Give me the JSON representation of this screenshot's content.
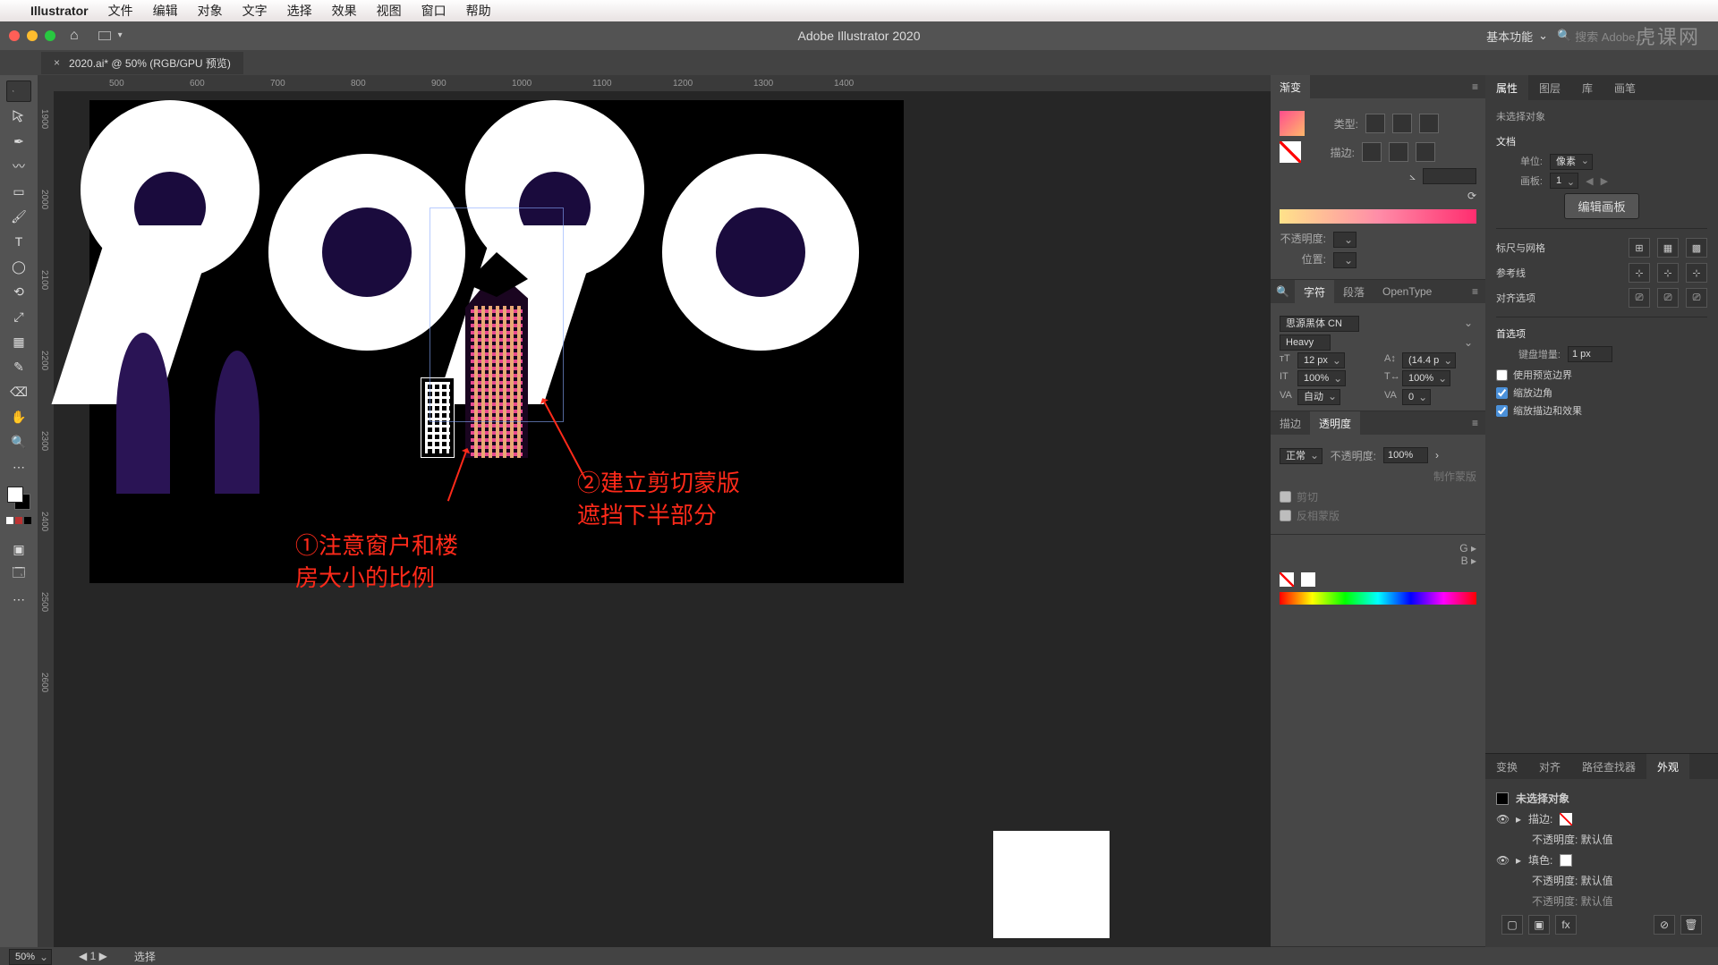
{
  "mac_menu": {
    "apple": "",
    "app": "Illustrator",
    "items": [
      "文件",
      "编辑",
      "对象",
      "文字",
      "选择",
      "效果",
      "视图",
      "窗口",
      "帮助"
    ]
  },
  "titlebar": {
    "title": "Adobe Illustrator 2020",
    "workspace": "基本功能",
    "search_placeholder": "搜索 Adobe..."
  },
  "watermark": "虎课网",
  "doctab": {
    "name": "2020.ai* @ 50% (RGB/GPU 预览)"
  },
  "ruler_h": [
    "500",
    "600",
    "700",
    "800",
    "900",
    "1000",
    "1100",
    "1200",
    "1300",
    "1400"
  ],
  "ruler_v": [
    "1900",
    "2000",
    "2100",
    "2200",
    "2300",
    "2400",
    "2500",
    "2600"
  ],
  "annotations": {
    "a1_l1": "①注意窗户和楼",
    "a1_l2": "房大小的比例",
    "a2_l1": "②建立剪切蒙版",
    "a2_l2": "遮挡下半部分"
  },
  "gradient": {
    "tab": "渐变",
    "type_label": "类型:",
    "stroke_label": "描边:",
    "opacity_label": "不透明度:",
    "position_label": "位置:"
  },
  "character": {
    "tab_char": "字符",
    "tab_para": "段落",
    "tab_ot": "OpenType",
    "font": "思源黑体 CN",
    "weight": "Heavy",
    "size": "12 px",
    "leading": "(14.4 p",
    "hscale": "100%",
    "vscale": "100%",
    "kerning": "自动",
    "tracking": "0"
  },
  "trans": {
    "tab_stroke": "描边",
    "tab_trans": "透明度",
    "blend": "正常",
    "opacity_label": "不透明度:",
    "opacity": "100%",
    "make_mask": "制作蒙版",
    "clip": "剪切",
    "invert": "反相蒙版"
  },
  "props": {
    "tab_props": "属性",
    "tab_layers": "图层",
    "tab_lib": "库",
    "tab_brush": "画笔",
    "no_sel": "未选择对象",
    "doc": "文档",
    "unit_label": "单位:",
    "unit": "像素",
    "artboard_label": "画板:",
    "artboard": "1",
    "edit_artboard": "编辑画板",
    "ruler_grid": "标尺与网格",
    "guides": "参考线",
    "align": "对齐选项",
    "prefs": "首选项",
    "kb_inc_label": "键盘增量:",
    "kb_inc": "1 px",
    "cb1": "使用预览边界",
    "cb2": "缩放边角",
    "cb3": "缩放描边和效果"
  },
  "appearance": {
    "tab_trans": "变换",
    "tab_align": "对齐",
    "tab_path": "路径查找器",
    "tab_app": "外观",
    "no_sel": "未选择对象",
    "stroke": "描边:",
    "op_default": "不透明度: 默认值",
    "fill": "填色:",
    "op_default2": "不透明度: 默认值",
    "op_default3": "不透明度: 默认值"
  },
  "status": {
    "zoom": "50%",
    "artboard_nav": "1",
    "mid": "选择"
  },
  "colors": {
    "accent": "#ff2a1a"
  }
}
